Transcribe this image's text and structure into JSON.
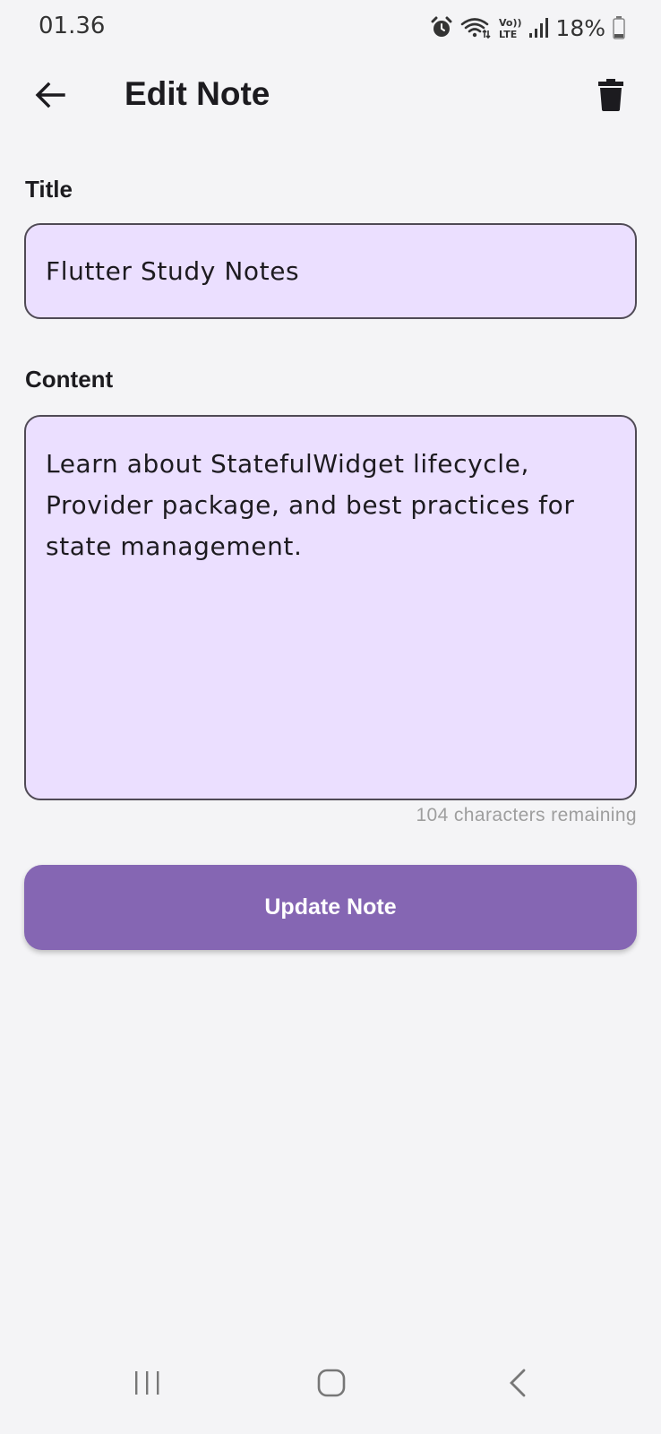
{
  "status_bar": {
    "time": "01.36",
    "battery_percent": "18%",
    "icons": [
      "alarm-icon",
      "wifi-icon",
      "volte-icon",
      "signal-icon",
      "battery-icon"
    ]
  },
  "app_bar": {
    "title": "Edit Note",
    "back_icon": "arrow-left-icon",
    "delete_icon": "trash-icon"
  },
  "form": {
    "title_label": "Title",
    "title_value": "Flutter Study Notes",
    "content_label": "Content",
    "content_value": "Learn about StatefulWidget lifecycle,\nProvider package, and best practices for\nstate management.",
    "char_counter": "104 characters remaining",
    "submit_label": "Update Note"
  },
  "colors": {
    "background": "#f4f4f6",
    "input_fill": "#ebdfff",
    "input_border": "#4f4a55",
    "primary_button": "#8566b3",
    "button_text": "#ffffff",
    "counter_text": "#9e9e9e"
  },
  "nav_bar": {
    "buttons": [
      "recents-icon",
      "home-icon",
      "back-icon"
    ]
  }
}
